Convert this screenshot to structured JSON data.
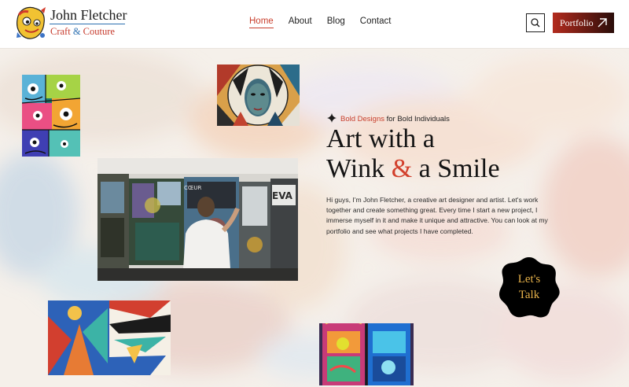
{
  "brand": {
    "name": "John Fletcher",
    "sub_part1": "Craft",
    "sub_amp": "&",
    "sub_part2": "Couture"
  },
  "nav": {
    "items": [
      {
        "label": "Home",
        "active": true
      },
      {
        "label": "About",
        "active": false
      },
      {
        "label": "Blog",
        "active": false
      },
      {
        "label": "Contact",
        "active": false
      }
    ]
  },
  "header": {
    "search_icon": "search-icon",
    "portfolio_label": "Portfolio",
    "portfolio_icon": "arrow-up-right-icon"
  },
  "hero": {
    "tagline_accent": "Bold Designs",
    "tagline_rest": " for Bold Individuals",
    "headline_line1": "Art with a",
    "headline_word": "Wink",
    "headline_amp": "&",
    "headline_end": "a Smile",
    "intro": "Hi guys, I'm John Fletcher, a creative art designer and artist. Let's work together and create something great. Every time I start a new project, I immerse myself in it and make it unique and attractive. You can look at my portfolio and see what projects I have completed.",
    "cta_line1": "Let's",
    "cta_line2": "Talk"
  },
  "colors": {
    "accent": "#c9402e",
    "cta_bg": "#000000",
    "cta_text": "#e7b24a",
    "button_dark": "#2a0d09"
  }
}
